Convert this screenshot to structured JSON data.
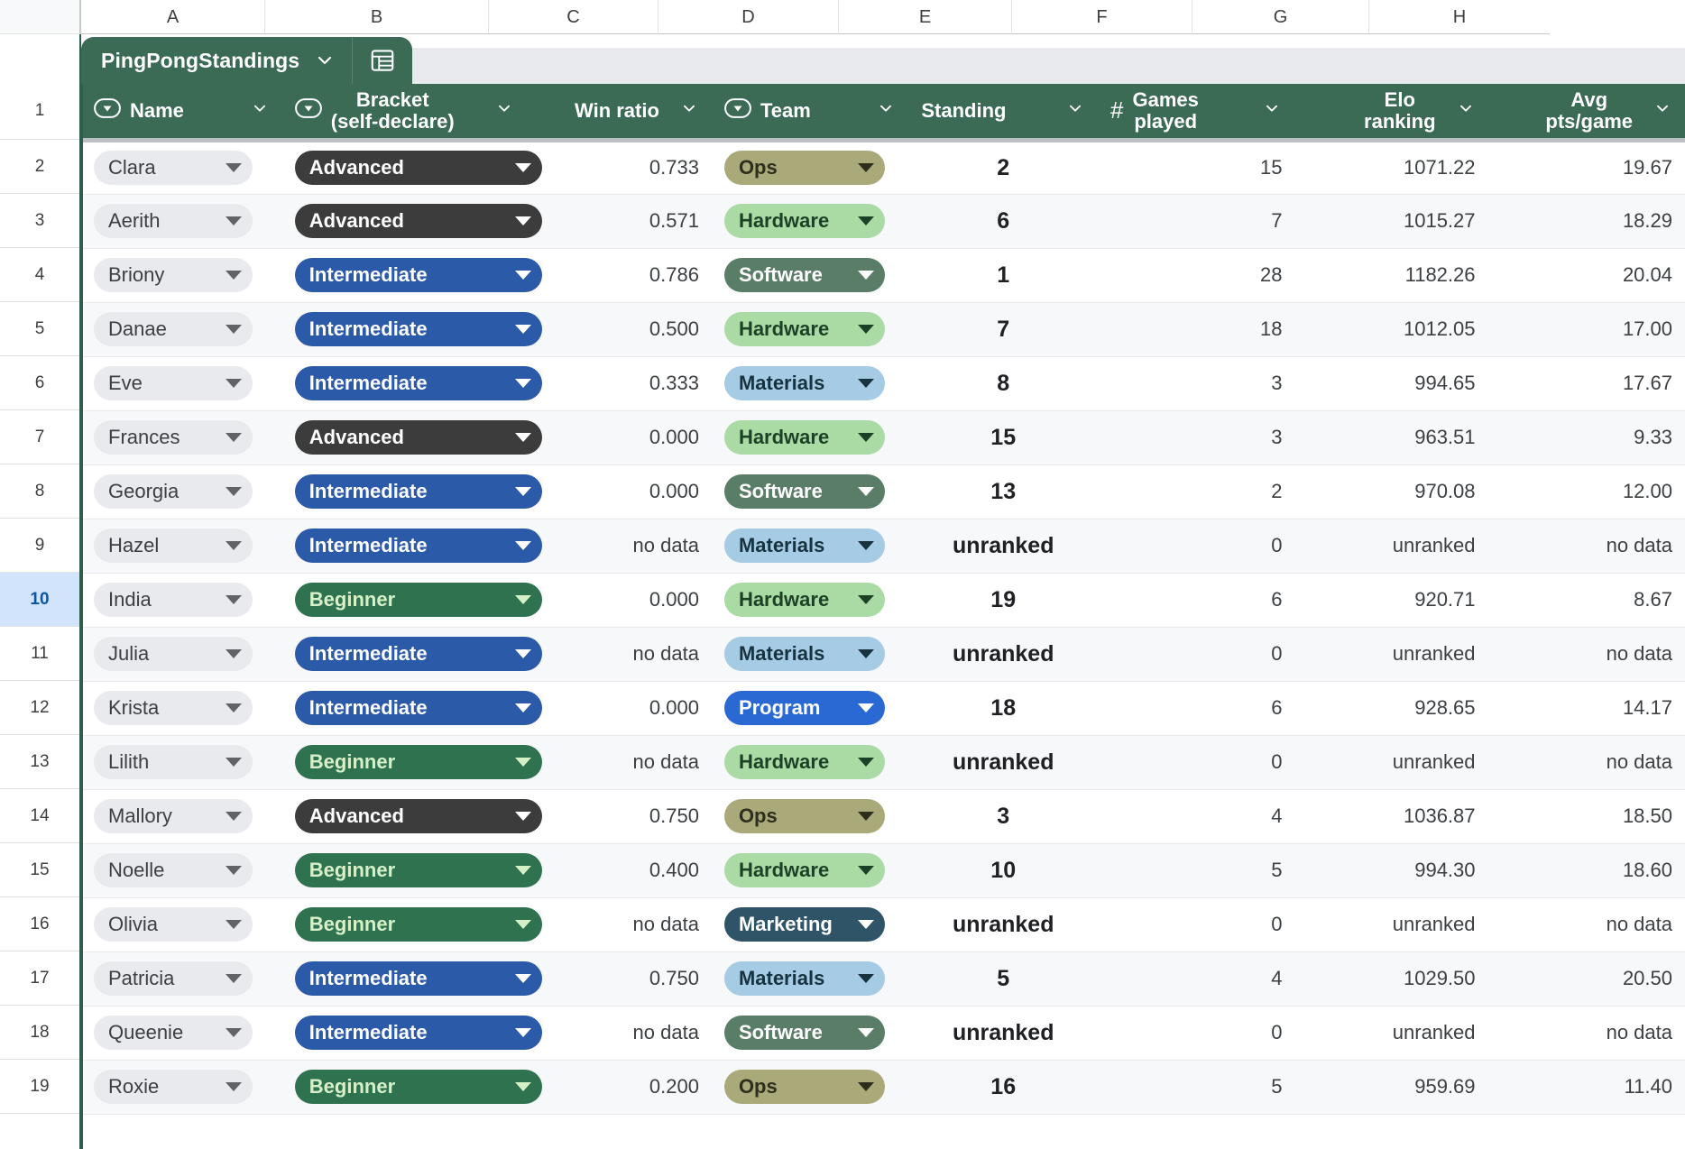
{
  "spreadsheet": {
    "column_letters": [
      "A",
      "B",
      "C",
      "D",
      "E",
      "F",
      "G",
      "H"
    ],
    "row_numbers": [
      "1",
      "2",
      "3",
      "4",
      "5",
      "6",
      "7",
      "8",
      "9",
      "10",
      "11",
      "12",
      "13",
      "14",
      "15",
      "16",
      "17",
      "18",
      "19"
    ],
    "selected_row": "10"
  },
  "tab": {
    "name": "PingPongStandings",
    "caret_icon": "chevron-down-icon",
    "table_icon": "table-chart-icon"
  },
  "table": {
    "columns": [
      {
        "label": "Name",
        "label2": "",
        "type_icon": "chip-dropdown-icon",
        "caret": "chevron-down-icon",
        "align": "left"
      },
      {
        "label": "Bracket",
        "label2": "(self-declare)",
        "type_icon": "chip-dropdown-icon",
        "caret": "chevron-down-icon",
        "align": "left"
      },
      {
        "label": "Win ratio",
        "label2": "",
        "type_icon": "",
        "caret": "chevron-down-icon",
        "align": "right"
      },
      {
        "label": "Team",
        "label2": "",
        "type_icon": "chip-dropdown-icon",
        "caret": "chevron-down-icon",
        "align": "left"
      },
      {
        "label": "Standing",
        "label2": "",
        "type_icon": "",
        "caret": "chevron-down-icon",
        "align": "center"
      },
      {
        "label": "Games",
        "label2": "played",
        "type_icon": "hash-icon",
        "caret": "chevron-down-icon",
        "align": "center"
      },
      {
        "label": "Elo",
        "label2": "ranking",
        "type_icon": "",
        "caret": "chevron-down-icon",
        "align": "right"
      },
      {
        "label": "Avg",
        "label2": "pts/game",
        "type_icon": "",
        "caret": "chevron-down-icon",
        "align": "right"
      }
    ],
    "rows": [
      {
        "name": "Clara",
        "bracket": "Advanced",
        "bracket_class": "advanced",
        "win_ratio": "0.733",
        "team": "Ops",
        "team_class": "ops",
        "standing": "2",
        "games": "15",
        "elo": "1071.22",
        "avg": "19.67"
      },
      {
        "name": "Aerith",
        "bracket": "Advanced",
        "bracket_class": "advanced",
        "win_ratio": "0.571",
        "team": "Hardware",
        "team_class": "hardware",
        "standing": "6",
        "games": "7",
        "elo": "1015.27",
        "avg": "18.29"
      },
      {
        "name": "Briony",
        "bracket": "Intermediate",
        "bracket_class": "intermediate",
        "win_ratio": "0.786",
        "team": "Software",
        "team_class": "software",
        "standing": "1",
        "games": "28",
        "elo": "1182.26",
        "avg": "20.04"
      },
      {
        "name": "Danae",
        "bracket": "Intermediate",
        "bracket_class": "intermediate",
        "win_ratio": "0.500",
        "team": "Hardware",
        "team_class": "hardware",
        "standing": "7",
        "games": "18",
        "elo": "1012.05",
        "avg": "17.00"
      },
      {
        "name": "Eve",
        "bracket": "Intermediate",
        "bracket_class": "intermediate",
        "win_ratio": "0.333",
        "team": "Materials",
        "team_class": "materials",
        "standing": "8",
        "games": "3",
        "elo": "994.65",
        "avg": "17.67"
      },
      {
        "name": "Frances",
        "bracket": "Advanced",
        "bracket_class": "advanced",
        "win_ratio": "0.000",
        "team": "Hardware",
        "team_class": "hardware",
        "standing": "15",
        "games": "3",
        "elo": "963.51",
        "avg": "9.33"
      },
      {
        "name": "Georgia",
        "bracket": "Intermediate",
        "bracket_class": "intermediate",
        "win_ratio": "0.000",
        "team": "Software",
        "team_class": "software",
        "standing": "13",
        "games": "2",
        "elo": "970.08",
        "avg": "12.00"
      },
      {
        "name": "Hazel",
        "bracket": "Intermediate",
        "bracket_class": "intermediate",
        "win_ratio": "no data",
        "team": "Materials",
        "team_class": "materials",
        "standing": "unranked",
        "games": "0",
        "elo": "unranked",
        "avg": "no data"
      },
      {
        "name": "India",
        "bracket": "Beginner",
        "bracket_class": "beginner",
        "win_ratio": "0.000",
        "team": "Hardware",
        "team_class": "hardware",
        "standing": "19",
        "games": "6",
        "elo": "920.71",
        "avg": "8.67"
      },
      {
        "name": "Julia",
        "bracket": "Intermediate",
        "bracket_class": "intermediate",
        "win_ratio": "no data",
        "team": "Materials",
        "team_class": "materials",
        "standing": "unranked",
        "games": "0",
        "elo": "unranked",
        "avg": "no data"
      },
      {
        "name": "Krista",
        "bracket": "Intermediate",
        "bracket_class": "intermediate",
        "win_ratio": "0.000",
        "team": "Program",
        "team_class": "program",
        "standing": "18",
        "games": "6",
        "elo": "928.65",
        "avg": "14.17"
      },
      {
        "name": "Lilith",
        "bracket": "Beginner",
        "bracket_class": "beginner",
        "win_ratio": "no data",
        "team": "Hardware",
        "team_class": "hardware",
        "standing": "unranked",
        "games": "0",
        "elo": "unranked",
        "avg": "no data"
      },
      {
        "name": "Mallory",
        "bracket": "Advanced",
        "bracket_class": "advanced",
        "win_ratio": "0.750",
        "team": "Ops",
        "team_class": "ops",
        "standing": "3",
        "games": "4",
        "elo": "1036.87",
        "avg": "18.50"
      },
      {
        "name": "Noelle",
        "bracket": "Beginner",
        "bracket_class": "beginner",
        "win_ratio": "0.400",
        "team": "Hardware",
        "team_class": "hardware",
        "standing": "10",
        "games": "5",
        "elo": "994.30",
        "avg": "18.60"
      },
      {
        "name": "Olivia",
        "bracket": "Beginner",
        "bracket_class": "beginner",
        "win_ratio": "no data",
        "team": "Marketing",
        "team_class": "marketing",
        "standing": "unranked",
        "games": "0",
        "elo": "unranked",
        "avg": "no data"
      },
      {
        "name": "Patricia",
        "bracket": "Intermediate",
        "bracket_class": "intermediate",
        "win_ratio": "0.750",
        "team": "Materials",
        "team_class": "materials",
        "standing": "5",
        "games": "4",
        "elo": "1029.50",
        "avg": "20.50"
      },
      {
        "name": "Queenie",
        "bracket": "Intermediate",
        "bracket_class": "intermediate",
        "win_ratio": "no data",
        "team": "Software",
        "team_class": "software",
        "standing": "unranked",
        "games": "0",
        "elo": "unranked",
        "avg": "no data"
      },
      {
        "name": "Roxie",
        "bracket": "Beginner",
        "bracket_class": "beginner",
        "win_ratio": "0.200",
        "team": "Ops",
        "team_class": "ops",
        "standing": "16",
        "games": "5",
        "elo": "959.69",
        "avg": "11.40"
      }
    ]
  },
  "colors": {
    "header_green": "#3b6a55",
    "tab_green": "#3b6a55",
    "selected_row": "#d2e3fc",
    "alt_row": "#f6f8f9",
    "advanced": "#3c3c3c",
    "intermediate": "#2a5aa8",
    "beginner": "#2e7250",
    "ops": "#a9a97a",
    "hardware": "#abdba4",
    "software": "#5a7d67",
    "materials": "#a6cce5",
    "program": "#2a68d4",
    "marketing": "#2f5468"
  }
}
